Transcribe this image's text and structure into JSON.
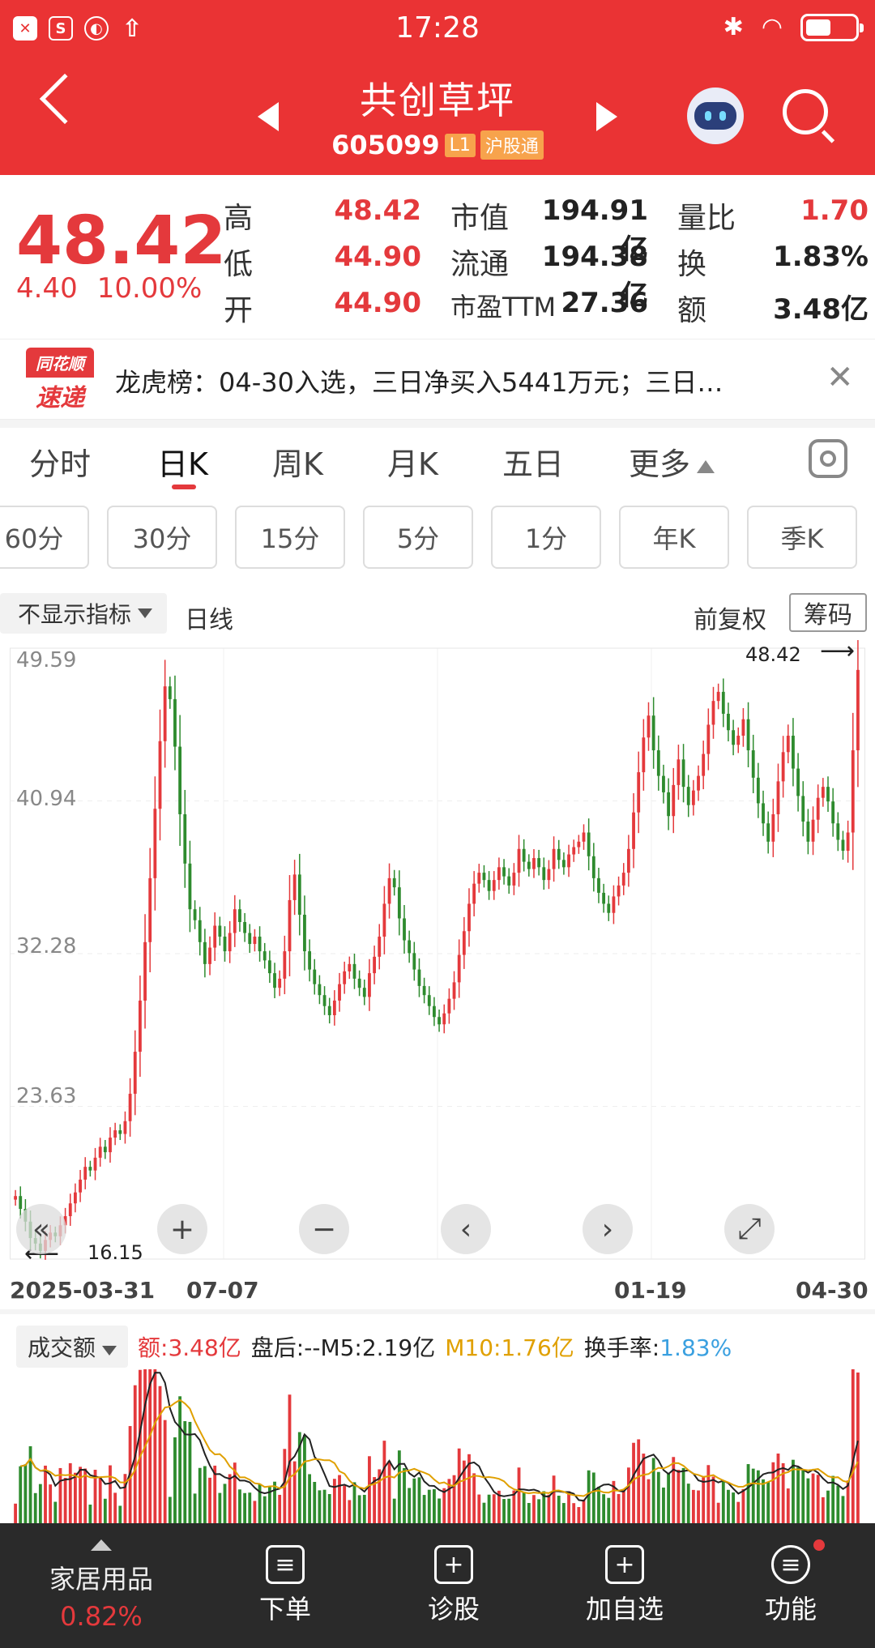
{
  "status_bar": {
    "time": "17:28"
  },
  "header": {
    "title": "共创草坪",
    "code": "605099",
    "level_tag": "L1",
    "market_tag": "沪股通"
  },
  "quote": {
    "price": "48.42",
    "change": "4.40",
    "change_pct": "10.00%",
    "stats": [
      {
        "label": "高",
        "value": "48.42",
        "color": "#e4393c"
      },
      {
        "label": "低",
        "value": "44.90",
        "color": "#e4393c"
      },
      {
        "label": "开",
        "value": "44.90",
        "color": "#e4393c"
      },
      {
        "label": "市值",
        "value": "194.91亿",
        "color": "#222"
      },
      {
        "label": "流通",
        "value": "194.38亿",
        "color": "#222"
      },
      {
        "label": "市盈TTM",
        "value": "27.36",
        "color": "#222"
      },
      {
        "label": "量比",
        "value": "1.70",
        "color": "#e4393c"
      },
      {
        "label": "换",
        "value": "1.83%",
        "color": "#222"
      },
      {
        "label": "额",
        "value": "3.48亿",
        "color": "#222"
      }
    ]
  },
  "news": {
    "logo_top": "同花顺",
    "logo_bottom": "速递",
    "text": "龙虎榜：04-30入选，三日净买入5441万元；三日…"
  },
  "tabs": [
    "分时",
    "日K",
    "周K",
    "月K",
    "五日",
    "更多"
  ],
  "selected_tab": "日K",
  "periods": [
    "60分",
    "30分",
    "15分",
    "5分",
    "1分",
    "年K",
    "季K"
  ],
  "indicator": {
    "selector": "不显示指标",
    "line_type": "日线",
    "adjust": "前复权",
    "chips_button": "筹码"
  },
  "chart_data": {
    "type": "candlestick",
    "y_ticks": [
      "49.59",
      "40.94",
      "32.28",
      "23.63",
      "16.15"
    ],
    "ylim": [
      16.15,
      49.59
    ],
    "x_labels": [
      "2025-03-31",
      "07-07",
      "01-19",
      "04-30"
    ],
    "max_label": "48.42",
    "min_label": "16.15",
    "up_color": "#e4393c",
    "down_color": "#2e8b2e",
    "closes": [
      19.6,
      18.9,
      18.2,
      17.3,
      17.0,
      16.6,
      17.2,
      17.6,
      17.4,
      18.0,
      18.5,
      19.2,
      19.8,
      20.5,
      21.2,
      21.0,
      21.7,
      22.3,
      22.0,
      22.8,
      23.2,
      23.0,
      23.7,
      25.2,
      27.5,
      30.3,
      33.5,
      37.0,
      40.8,
      44.5,
      47.5,
      46.8,
      44.2,
      40.5,
      37.8,
      35.3,
      34.7,
      33.5,
      32.3,
      33.2,
      34.4,
      33.8,
      33.0,
      34.0,
      35.3,
      34.6,
      34.0,
      33.4,
      33.8,
      33.0,
      32.5,
      31.8,
      31.0,
      31.5,
      33.0,
      35.8,
      37.2,
      35.0,
      33.0,
      32.0,
      31.2,
      30.6,
      30.0,
      29.5,
      30.3,
      31.2,
      31.9,
      32.3,
      31.5,
      31.0,
      30.5,
      31.8,
      32.7,
      33.8,
      35.6,
      37.0,
      36.5,
      34.8,
      33.6,
      32.9,
      32.0,
      31.1,
      30.6,
      30.0,
      29.4,
      29.0,
      29.6,
      30.4,
      31.3,
      32.8,
      34.1,
      35.6,
      36.7,
      37.3,
      36.9,
      36.3,
      36.9,
      37.6,
      37.1,
      36.6,
      37.3,
      38.6,
      37.9,
      37.5,
      38.1,
      37.6,
      36.9,
      37.5,
      38.6,
      38.0,
      37.6,
      38.3,
      38.7,
      39.0,
      39.5,
      38.2,
      37.0,
      36.2,
      35.6,
      35.1,
      36.0,
      36.6,
      37.3,
      38.6,
      40.6,
      42.8,
      44.7,
      45.9,
      44.0,
      42.6,
      41.7,
      40.4,
      42.1,
      43.5,
      42.0,
      41.0,
      41.8,
      42.6,
      43.8,
      45.4,
      46.7,
      47.2,
      46.0,
      45.1,
      44.3,
      44.8,
      45.7,
      44.0,
      42.5,
      41.1,
      40.0,
      39.0,
      40.5,
      42.3,
      43.9,
      44.8,
      43.0,
      41.5,
      40.1,
      39.0,
      40.2,
      41.4,
      42.0,
      41.2,
      40.0,
      39.1,
      38.5,
      39.5,
      44.0,
      48.4
    ]
  },
  "chart_controls": [
    "«",
    "+",
    "−",
    "‹",
    "›",
    "⤢"
  ],
  "volume": {
    "selector": "成交额",
    "amount_label": "额:3.48亿",
    "after_hours": "盘后:--",
    "m5": "M5:2.19亿",
    "m10": "M10:1.76亿",
    "turnover_label": "换手率:",
    "turnover_value": "1.83%",
    "m5_color": "#222",
    "m10_color": "#e0a000",
    "turnover_color": "#3aa0e0"
  },
  "bottom_nav": {
    "sector_name": "家居用品",
    "sector_pct": "0.82%",
    "items": [
      "下单",
      "诊股",
      "加自选",
      "功能"
    ]
  }
}
